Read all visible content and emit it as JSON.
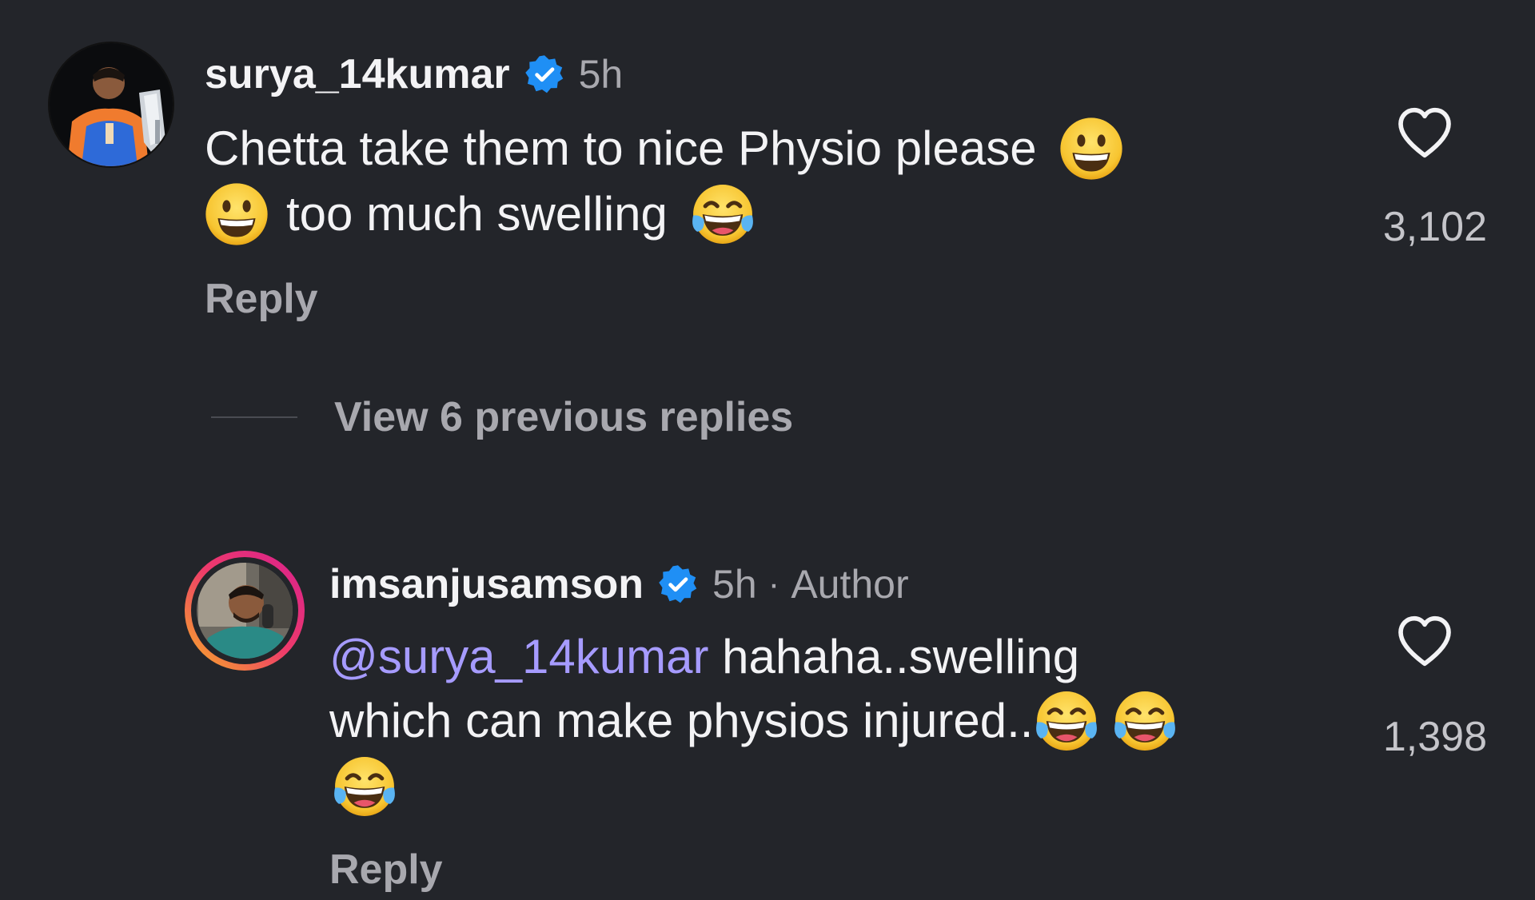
{
  "colors": {
    "background": "#23252a",
    "primary_text": "#f3f3f5",
    "secondary_text": "#a8a8ae",
    "mention": "#a69bff",
    "verified_badge": "#1f8ff5",
    "story_ring_start": "#f7b125",
    "story_ring_end": "#d8208f"
  },
  "comment1": {
    "username": "surya_14kumar",
    "time": "5h",
    "text_line1": "Chetta take them to nice Physio please",
    "text_line2": "too much swelling",
    "emojis": [
      "grinning-face-emoji",
      "grinning-face-emoji",
      "tears-of-joy-emoji"
    ],
    "like_count": "3,102",
    "reply_label": "Reply"
  },
  "view_replies": {
    "label": "View 6 previous replies"
  },
  "comment2": {
    "username": "imsanjusamson",
    "time": "5h",
    "separator": "·",
    "role": "Author",
    "mention": "@surya_14kumar",
    "text_line1": " hahaha..swelling",
    "text_line2": "which can make physios injured..",
    "emojis": [
      "tears-of-joy-emoji",
      "tears-of-joy-emoji",
      "tears-of-joy-emoji"
    ],
    "like_count": "1,398",
    "reply_label": "Reply"
  }
}
